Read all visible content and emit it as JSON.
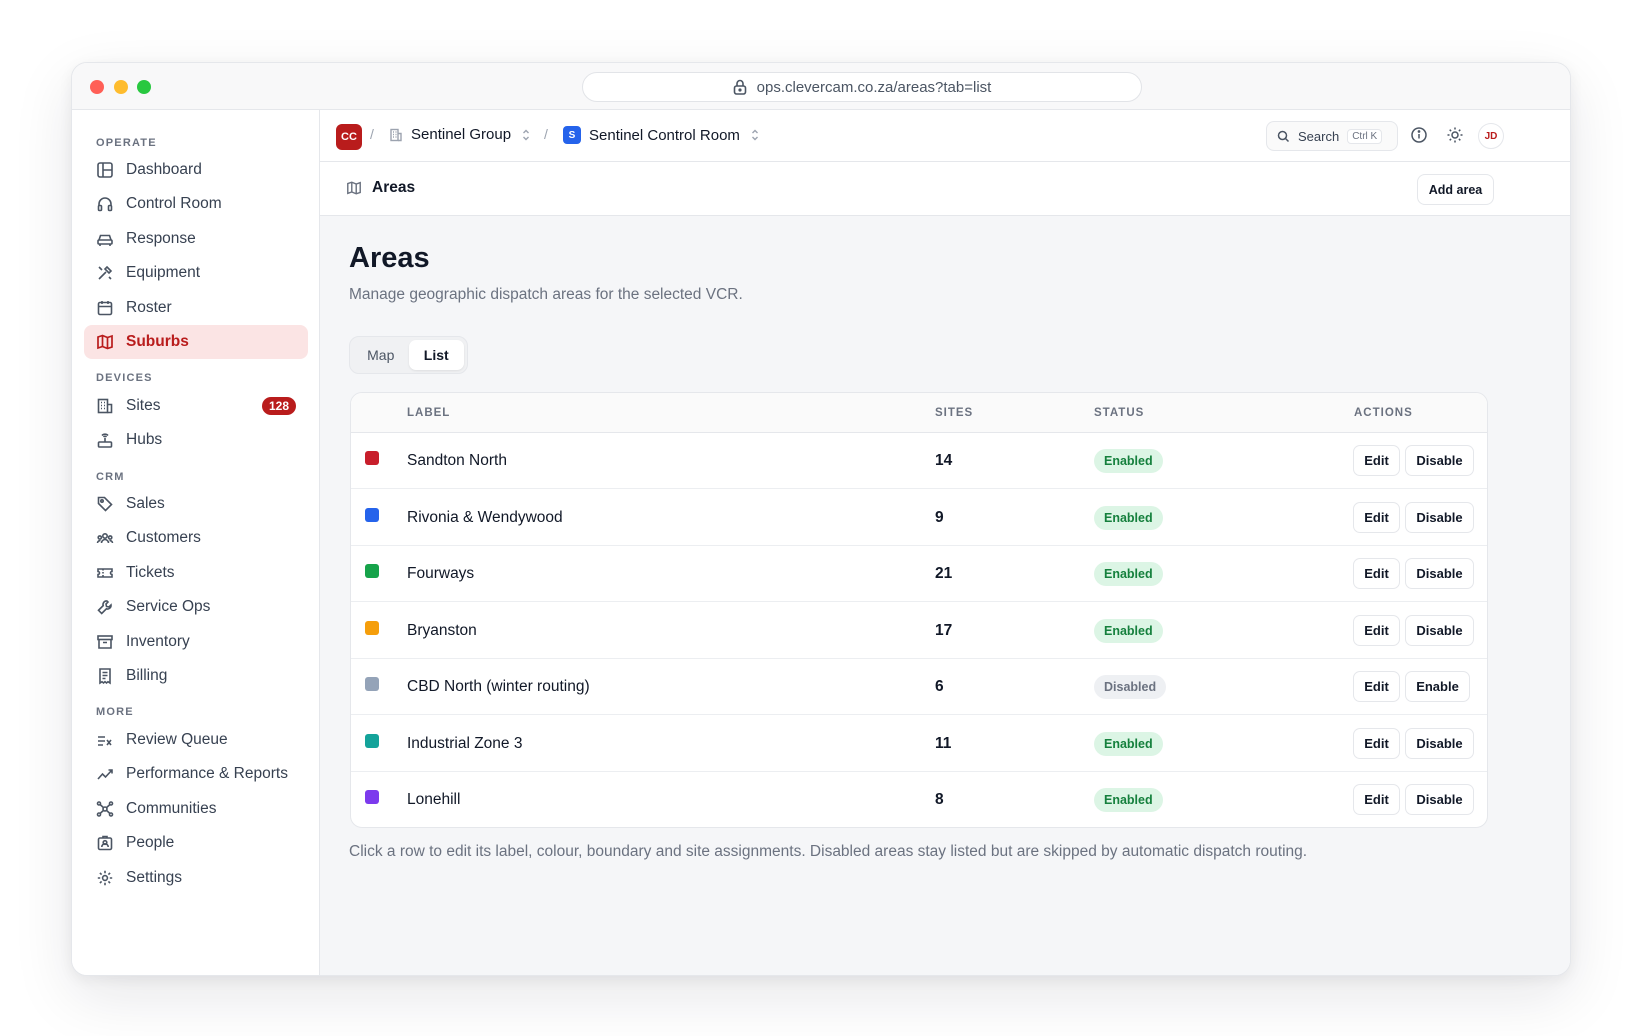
{
  "browser": {
    "url": "ops.clevercam.co.za/areas?tab=list"
  },
  "sidebar": {
    "sections": [
      {
        "label": "OPERATE"
      },
      {
        "label": "DEVICES"
      },
      {
        "label": "CRM"
      },
      {
        "label": "MORE"
      }
    ],
    "items": [
      {
        "label": "Dashboard",
        "icon": "layout-icon"
      },
      {
        "label": "Control Room",
        "icon": "headset-icon"
      },
      {
        "label": "Response",
        "icon": "car-icon"
      },
      {
        "label": "Equipment",
        "icon": "tools-icon"
      },
      {
        "label": "Roster",
        "icon": "calendar-icon"
      },
      {
        "label": "Suburbs",
        "icon": "map-icon",
        "active": true
      },
      {
        "label": "Sites",
        "icon": "building-icon",
        "badge": "128"
      },
      {
        "label": "Hubs",
        "icon": "router-icon"
      },
      {
        "label": "Sales",
        "icon": "tag-icon"
      },
      {
        "label": "Customers",
        "icon": "users-icon"
      },
      {
        "label": "Tickets",
        "icon": "ticket-icon"
      },
      {
        "label": "Service Ops",
        "icon": "wrench-icon"
      },
      {
        "label": "Inventory",
        "icon": "archive-icon"
      },
      {
        "label": "Billing",
        "icon": "receipt-icon"
      },
      {
        "label": "Review Queue",
        "icon": "list-check-icon"
      },
      {
        "label": "Performance & Reports",
        "icon": "trend-icon"
      },
      {
        "label": "Communities",
        "icon": "network-icon"
      },
      {
        "label": "People",
        "icon": "id-badge-icon"
      },
      {
        "label": "Settings",
        "icon": "gear-icon"
      }
    ]
  },
  "topbar": {
    "org_logo": "CC",
    "org_name": "Sentinel Group",
    "room_logo": "S",
    "room_name": "Sentinel Control Room",
    "search_label": "Search",
    "search_shortcut": "Ctrl K",
    "avatar_initials": "JD"
  },
  "subheader": {
    "title": "Areas",
    "add_button": "Add area"
  },
  "page": {
    "title": "Areas",
    "subtitle": "Manage geographic dispatch areas for the selected VCR.",
    "tabs": [
      {
        "label": "Map"
      },
      {
        "label": "List",
        "active": true
      }
    ],
    "footnote": "Click a row to edit its label, colour, boundary and site assignments. Disabled areas stay listed but are skipped by automatic dispatch routing."
  },
  "table": {
    "columns": {
      "label": "LABEL",
      "sites": "SITES",
      "status": "STATUS",
      "actions": "ACTIONS"
    },
    "rows": [
      {
        "label": "Sandton North",
        "sites": "14",
        "status": "Enabled",
        "color": "#c81e2b",
        "edit": "Edit",
        "toggle": "Disable"
      },
      {
        "label": "Rivonia & Wendywood",
        "sites": "9",
        "status": "Enabled",
        "color": "#2563eb",
        "edit": "Edit",
        "toggle": "Disable"
      },
      {
        "label": "Fourways",
        "sites": "21",
        "status": "Enabled",
        "color": "#16a34a",
        "edit": "Edit",
        "toggle": "Disable"
      },
      {
        "label": "Bryanston",
        "sites": "17",
        "status": "Enabled",
        "color": "#f59e0b",
        "edit": "Edit",
        "toggle": "Disable"
      },
      {
        "label": "CBD North (winter routing)",
        "sites": "6",
        "status": "Disabled",
        "color": "#94a3b8",
        "edit": "Edit",
        "toggle": "Enable"
      },
      {
        "label": "Industrial Zone 3",
        "sites": "11",
        "status": "Enabled",
        "color": "#14a39a",
        "edit": "Edit",
        "toggle": "Disable"
      },
      {
        "label": "Lonehill",
        "sites": "8",
        "status": "Enabled",
        "color": "#7c3aed",
        "edit": "Edit",
        "toggle": "Disable"
      }
    ]
  }
}
